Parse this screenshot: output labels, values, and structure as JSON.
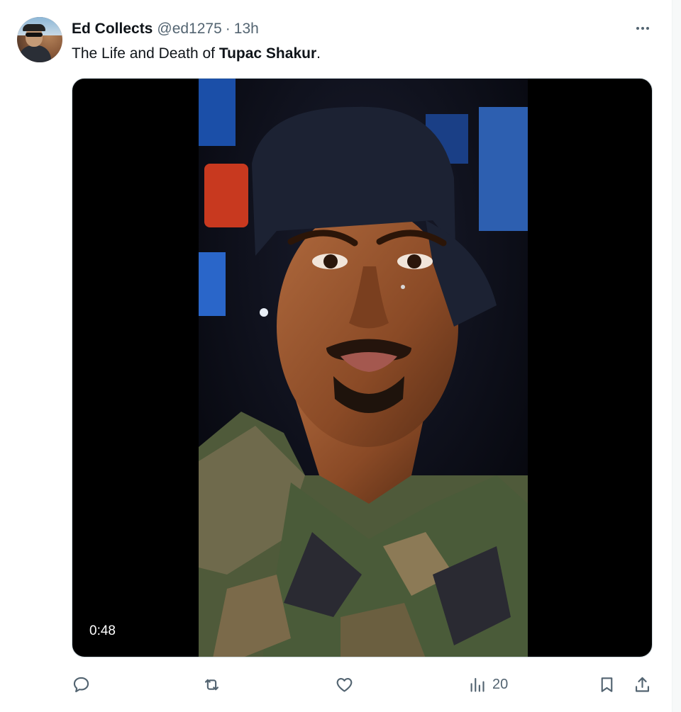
{
  "author": {
    "name": "Ed Collects",
    "handle": "@ed1275",
    "separator": "·",
    "time": "13h"
  },
  "tweet": {
    "text_prefix": "The Life and Death of ",
    "text_bold": "Tupac Shakur",
    "text_suffix": "."
  },
  "media": {
    "type": "video",
    "duration": "0:48"
  },
  "actions": {
    "reply_icon": "reply-icon",
    "retweet_icon": "retweet-icon",
    "like_icon": "like-icon",
    "views_icon": "views-icon",
    "views_count": "20",
    "bookmark_icon": "bookmark-icon",
    "share_icon": "share-icon"
  },
  "colors": {
    "secondary_text": "#536471",
    "primary_text": "#0f1419",
    "media_background": "#000000"
  }
}
